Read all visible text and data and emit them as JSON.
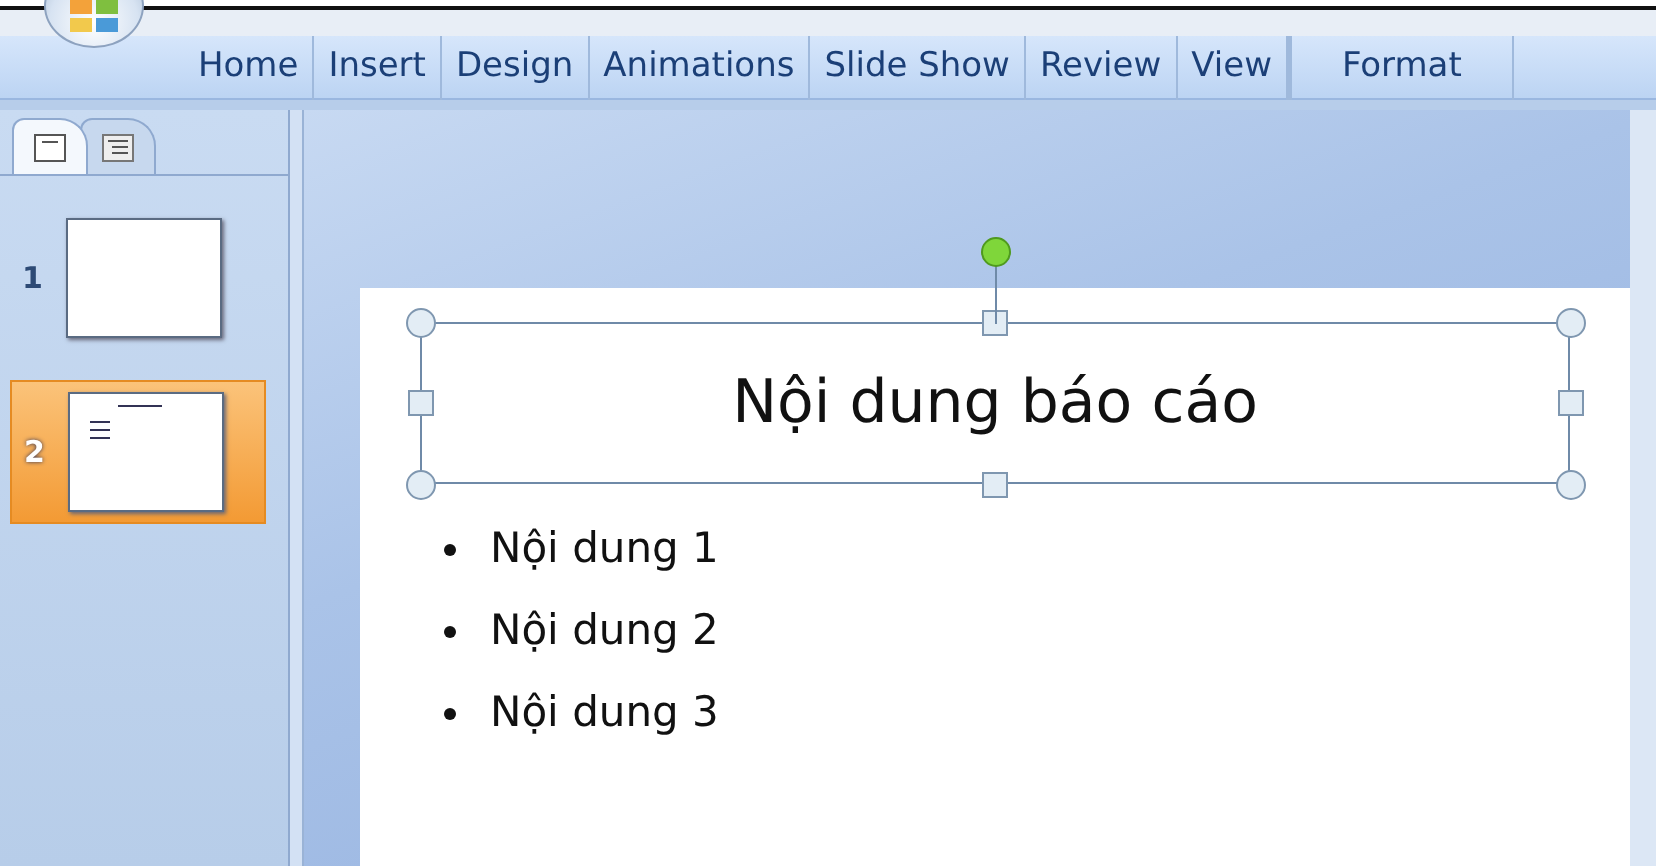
{
  "ribbon_tabs": [
    {
      "label": "Home",
      "kind": "tab"
    },
    {
      "label": "Insert",
      "kind": "tab"
    },
    {
      "label": "Design",
      "kind": "tab"
    },
    {
      "label": "Animations",
      "kind": "tab"
    },
    {
      "label": "Slide Show",
      "kind": "tab"
    },
    {
      "label": "Review",
      "kind": "tab"
    },
    {
      "label": "View",
      "kind": "tab"
    },
    {
      "label": "Format",
      "kind": "contextual"
    }
  ],
  "panel_tabs": [
    {
      "kind": "slides",
      "selected": true
    },
    {
      "kind": "outline",
      "selected": false
    }
  ],
  "slides": [
    {
      "number": "1",
      "kind": "blank",
      "selected": false
    },
    {
      "number": "2",
      "kind": "content",
      "selected": true
    }
  ],
  "slide": {
    "title": "Nội dung báo cáo",
    "title_selected": true,
    "bullets": [
      "Nội dung 1",
      "Nội dung 2",
      "Nội dung 3"
    ]
  }
}
